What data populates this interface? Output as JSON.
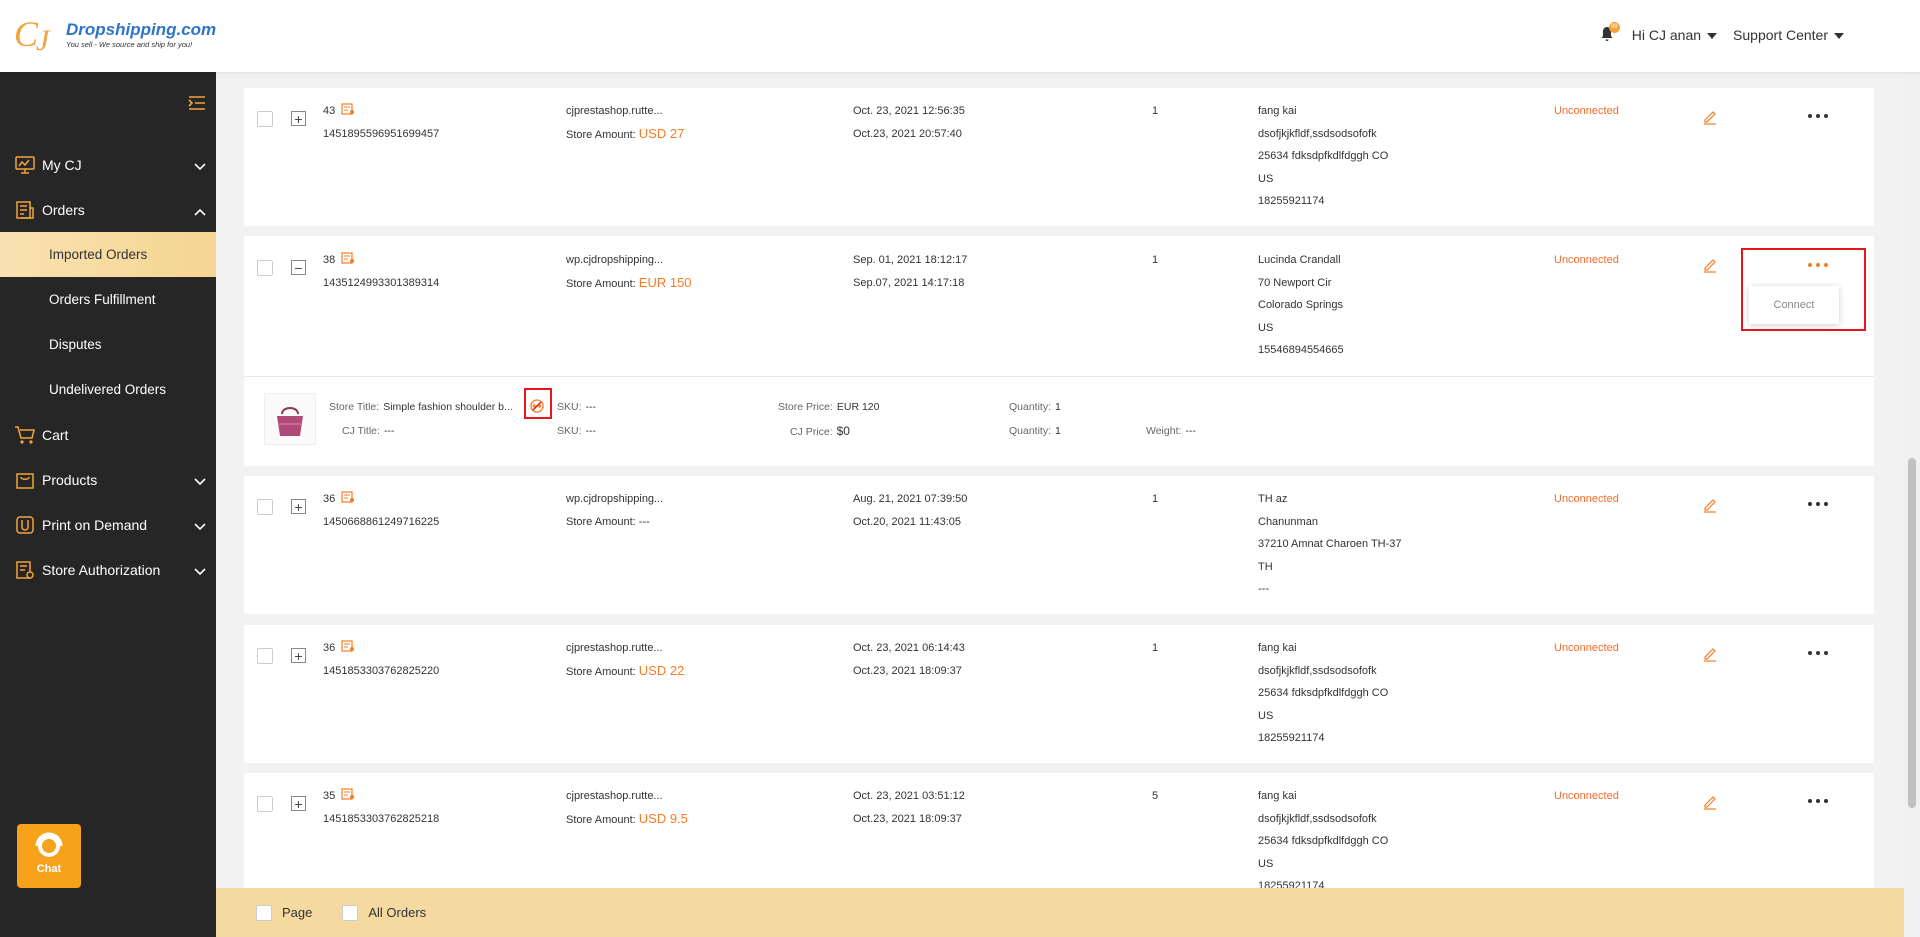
{
  "header": {
    "brand": "Dropshipping.com",
    "slogan": "You sell - We source and ship for you!",
    "notification_count": "99",
    "user_menu": "Hi CJ anan",
    "support_menu": "Support Center"
  },
  "sidebar": {
    "items": [
      {
        "label": "My CJ",
        "icon": "monitor-chart-icon",
        "expanded": false
      },
      {
        "label": "Orders",
        "icon": "orders-list-icon",
        "expanded": true,
        "children": [
          "Imported Orders",
          "Orders Fulfillment",
          "Disputes",
          "Undelivered Orders"
        ],
        "active_child": "Imported Orders"
      },
      {
        "label": "Cart",
        "icon": "cart-icon"
      },
      {
        "label": "Products",
        "icon": "bag-icon",
        "expanded": false
      },
      {
        "label": "Print on Demand",
        "icon": "print-icon",
        "expanded": false
      },
      {
        "label": "Store Authorization",
        "icon": "store-auth-icon",
        "expanded": false
      }
    ],
    "chat_label": "Chat"
  },
  "orders": [
    {
      "num": "43",
      "id": "1451895596951699457",
      "store": "cjprestashop.rutte...",
      "amount_label": "Store Amount:",
      "amount": "USD 27",
      "date1": "Oct. 23, 2021 12:56:35",
      "date2": "Oct.23, 2021 20:57:40",
      "qty": "1",
      "addr": [
        "fang kai",
        "dsofjkjkfldf,ssdsodsofofk",
        "25634 fdksdpfkdlfdggh CO",
        "US",
        "18255921174"
      ],
      "status": "Unconnected"
    },
    {
      "num": "38",
      "id": "1435124993301389314",
      "store": "wp.cjdropshipping...",
      "amount_label": "Store Amount:",
      "amount": "EUR 150",
      "date1": "Sep. 01, 2021 18:12:17",
      "date2": "Sep.07, 2021 14:17:18",
      "qty": "1",
      "addr": [
        "Lucinda Crandall",
        "70 Newport Cir",
        "Colorado Springs",
        "US",
        "15546894554665"
      ],
      "status": "Unconnected"
    },
    {
      "num": "36",
      "id": "1450668861249716225",
      "store": "wp.cjdropshipping...",
      "amount_label": "Store Amount:",
      "amount": "---",
      "date1": "Aug. 21, 2021 07:39:50",
      "date2": "Oct.20, 2021 11:43:05",
      "qty": "1",
      "addr": [
        "TH az",
        "Chanunman",
        "37210 Amnat Charoen TH-37",
        "TH",
        "---"
      ],
      "status": "Unconnected"
    },
    {
      "num": "36",
      "id": "1451853303762825220",
      "store": "cjprestashop.rutte...",
      "amount_label": "Store Amount:",
      "amount": "USD 22",
      "date1": "Oct. 23, 2021 06:14:43",
      "date2": "Oct.23, 2021 18:09:37",
      "qty": "1",
      "addr": [
        "fang kai",
        "dsofjkjkfldf,ssdsodsofofk",
        "25634 fdksdpfkdlfdggh CO",
        "US",
        "18255921174"
      ],
      "status": "Unconnected"
    },
    {
      "num": "35",
      "id": "1451853303762825218",
      "store": "cjprestashop.rutte...",
      "amount_label": "Store Amount:",
      "amount": "USD 9.5",
      "date1": "Oct. 23, 2021 03:51:12",
      "date2": "Oct.23, 2021 18:09:37",
      "qty": "5",
      "addr": [
        "fang kai",
        "dsofjkjkfldf,ssdsodsofofk",
        "25634 fdksdpfkdlfdggh CO",
        "US",
        "18255921174"
      ],
      "status": "Unconnected"
    }
  ],
  "product": {
    "store_title_label": "Store Title:",
    "store_title": "Simple fashion shoulder b...",
    "sku_label": "SKU:",
    "sku1": "---",
    "store_price_label": "Store Price:",
    "store_price": "EUR 120",
    "qty_label": "Quantity:",
    "qty1": "1",
    "cj_title_label": "CJ Title:",
    "cj_title": "---",
    "sku2": "---",
    "cj_price_label": "CJ Price:",
    "cj_price": "$0",
    "qty2": "1",
    "weight_label": "Weight:",
    "weight": "---"
  },
  "popover": {
    "connect_label": "Connect"
  },
  "footer": {
    "page_label": "Page",
    "all_label": "All Orders"
  },
  "colors": {
    "accent": "#f57c22",
    "sidebar_bg": "#262626",
    "active_bg": "#f6d592",
    "highlight": "#e8151b"
  }
}
